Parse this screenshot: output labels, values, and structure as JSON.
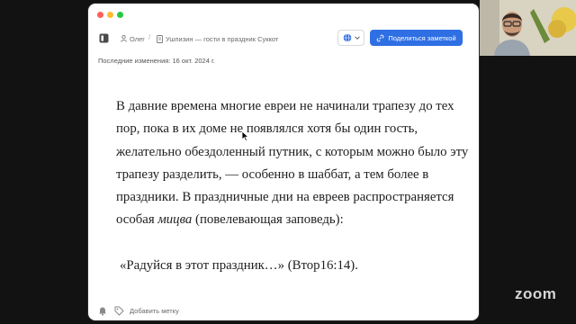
{
  "toolbar": {
    "breadcrumb_user": "Олег",
    "breadcrumb_doc": "Ушпизин — гости в праздник Суккот",
    "share_label": "Поделиться заметкой"
  },
  "document": {
    "last_modified": "Последние изменения: 16 окт. 2024 г.",
    "paragraph_before_italic": "В давние времена многие евреи не начинали трапезу до тех пор, пока в их доме не появлялся хотя бы один гость, желательно обездоленный путник, с которым можно было эту трапезу разделить, — особенно в шаббат, а тем более в праздники. В праздничные дни на евреев распространяется особая ",
    "paragraph_italic": "мицва",
    "paragraph_after_italic": " (повелевающая заповедь):",
    "quote": "«Радуйся в этот праздник…» (Втор16:14)."
  },
  "bottombar": {
    "add_tag_label": "Добавить метку"
  },
  "overlay": {
    "zoom_logo": "zoom"
  },
  "colors": {
    "accent": "#2f6fe4",
    "background": "#121212"
  },
  "icons": [
    "sidebar-toggle-icon",
    "user-icon",
    "document-icon",
    "globe-icon",
    "chevron-down-icon",
    "share-icon",
    "bell-icon",
    "tag-icon",
    "cursor-icon"
  ]
}
